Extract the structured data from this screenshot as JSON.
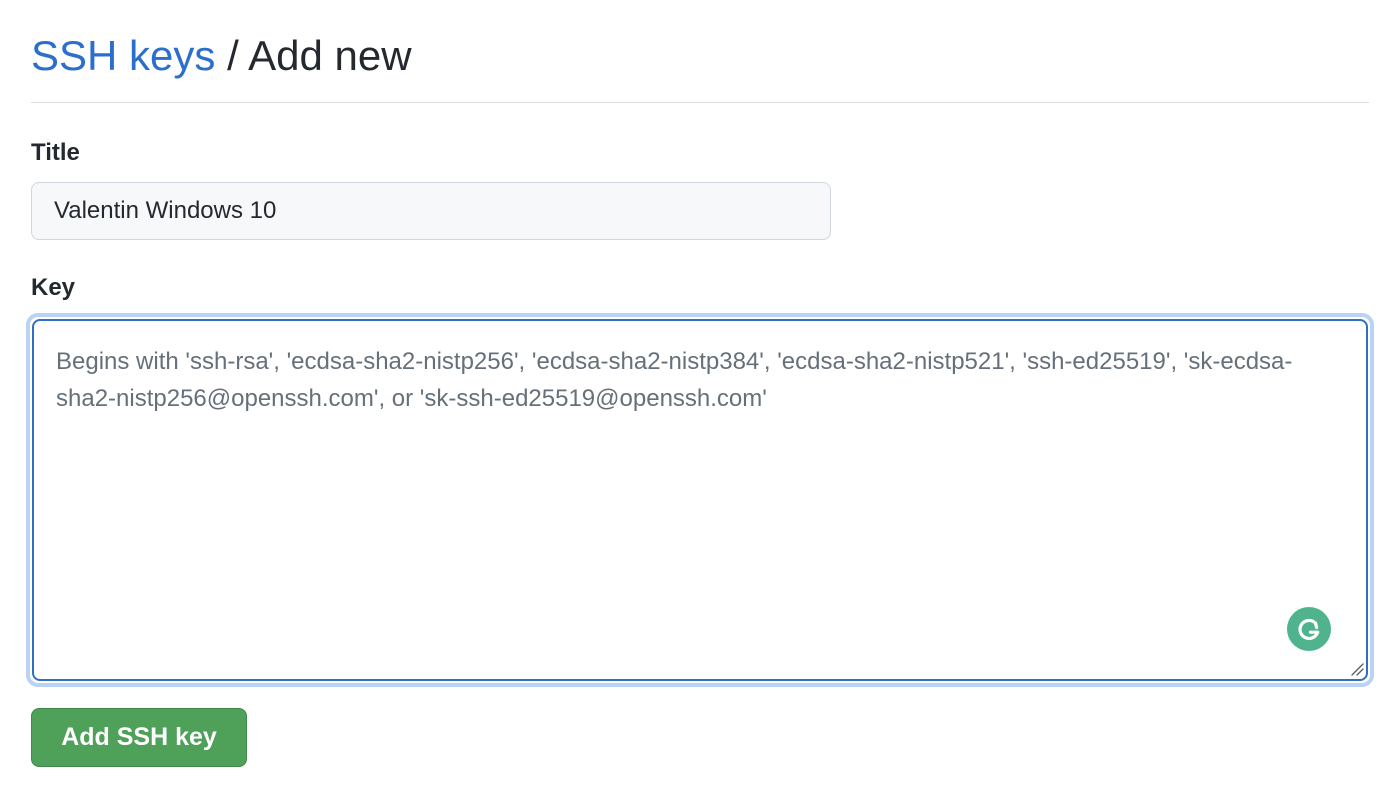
{
  "header": {
    "breadcrumb_link": "SSH keys",
    "separator": "/",
    "current": "Add new"
  },
  "form": {
    "title_label": "Title",
    "title_value": "Valentin Windows 10",
    "key_label": "Key",
    "key_placeholder": "Begins with 'ssh-rsa', 'ecdsa-sha2-nistp256', 'ecdsa-sha2-nistp384', 'ecdsa-sha2-nistp521', 'ssh-ed25519', 'sk-ecdsa-sha2-nistp256@openssh.com', or 'sk-ssh-ed25519@openssh.com'",
    "key_value": "",
    "submit_label": "Add SSH key"
  },
  "icons": {
    "grammarly": "grammarly-icon",
    "resize": "resize-handle-icon"
  },
  "colors": {
    "link_blue": "#2c6ecb",
    "focus_ring": "#b9d3f7",
    "focus_border": "#2f6fc4",
    "button_green": "#4fa15a",
    "grammarly_green": "#4fb48d"
  }
}
